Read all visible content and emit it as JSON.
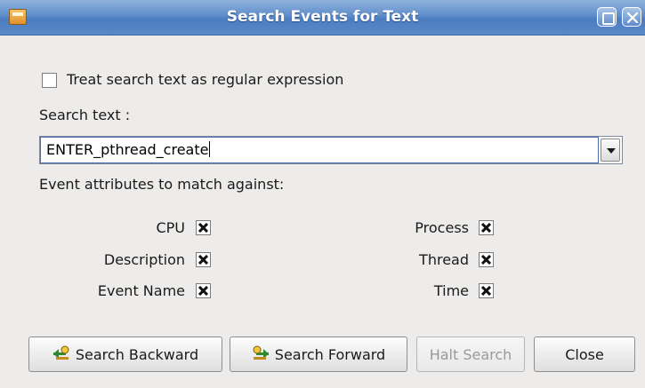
{
  "window": {
    "title": "Search Events for Text"
  },
  "options": {
    "regex_label": "Treat search text as regular expression",
    "regex_checked": false
  },
  "search": {
    "label": "Search text :",
    "value": "ENTER_pthread_create"
  },
  "attributes": {
    "heading": "Event attributes to match against:",
    "left": [
      {
        "label": "CPU",
        "checked": true
      },
      {
        "label": "Description",
        "checked": true
      },
      {
        "label": "Event Name",
        "checked": true
      }
    ],
    "right": [
      {
        "label": "Process",
        "checked": true
      },
      {
        "label": "Thread",
        "checked": true
      },
      {
        "label": "Time",
        "checked": true
      }
    ]
  },
  "buttons": {
    "search_backward": "Search Backward",
    "search_forward": "Search Forward",
    "halt_search": "Halt Search",
    "close": "Close"
  },
  "colors": {
    "titlebar": "#5f8dca",
    "background": "#edeceb"
  }
}
